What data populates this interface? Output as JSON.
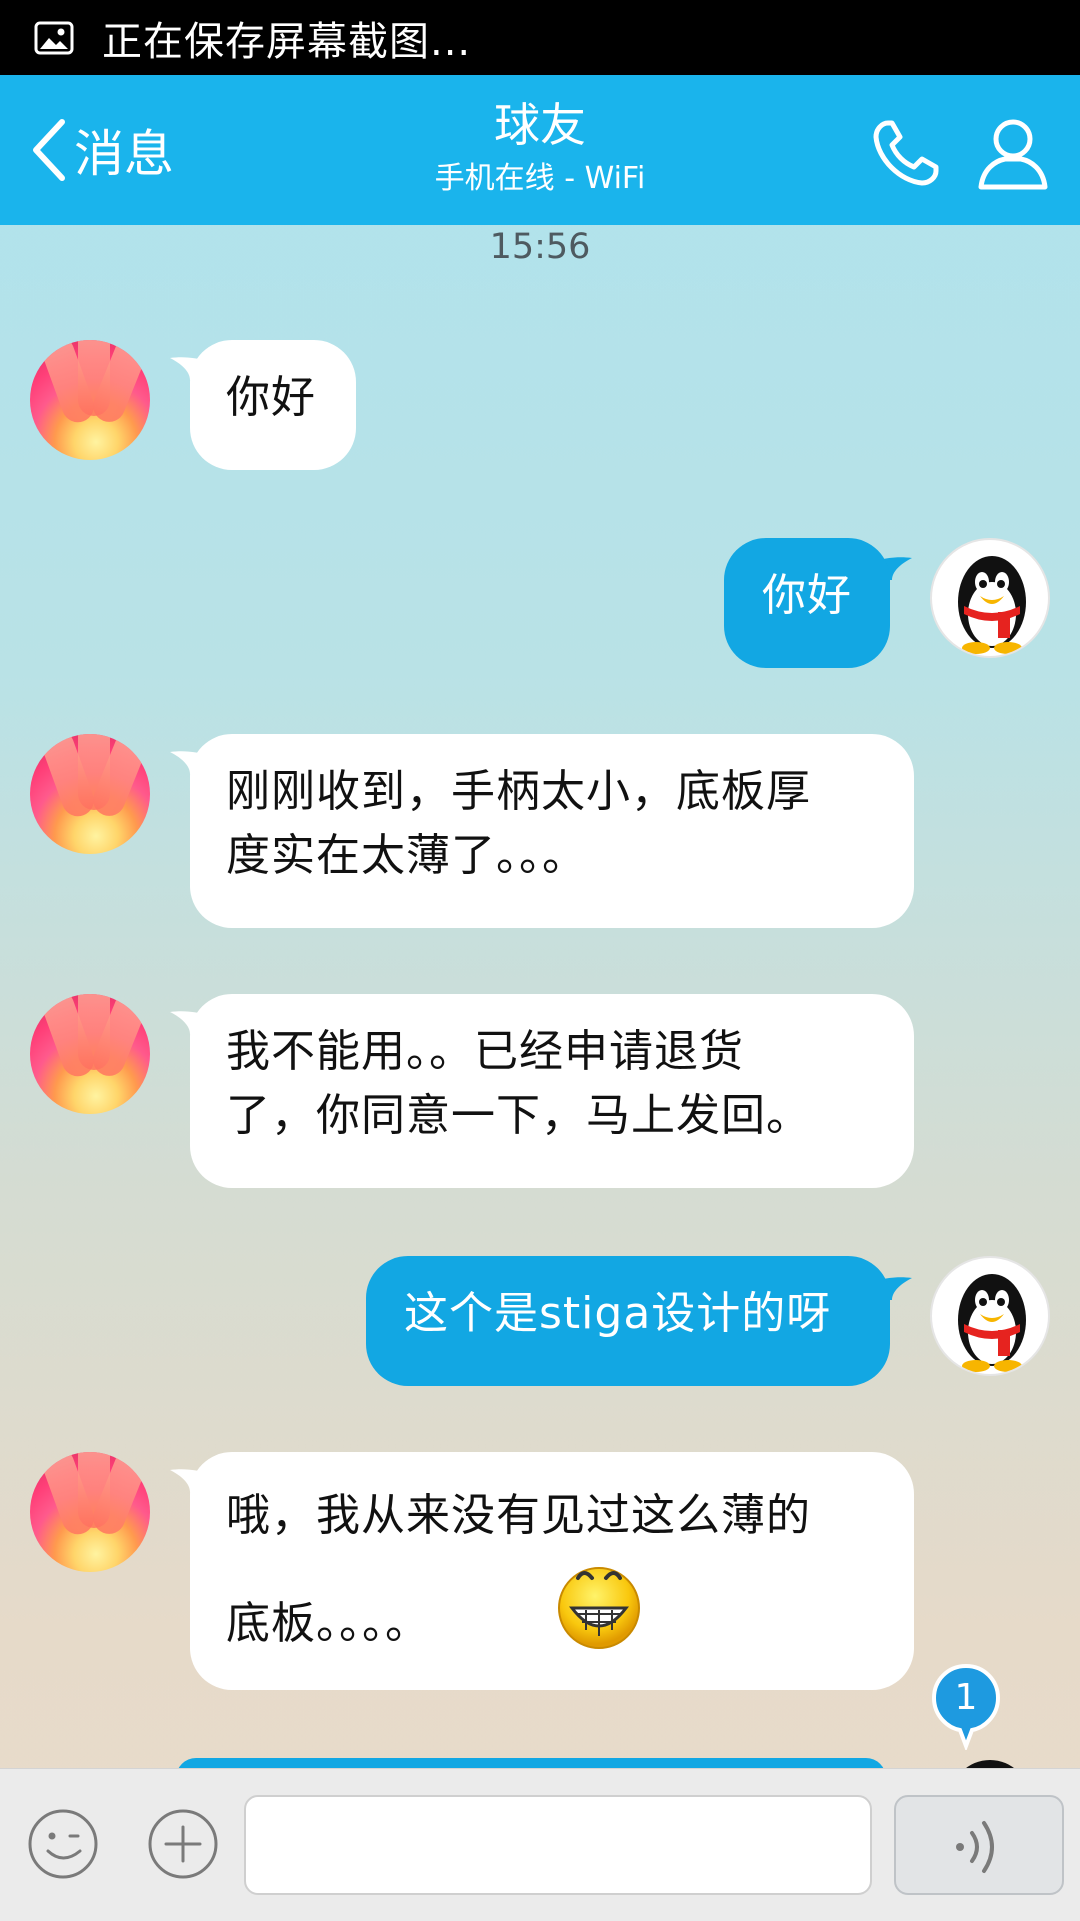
{
  "status_bar": {
    "notification": "正在保存屏幕截图..."
  },
  "header": {
    "back_label": "消息",
    "title": "球友",
    "subtitle": "手机在线 - WiFi"
  },
  "conversation": {
    "timestamp": "15:56",
    "messages": [
      {
        "side": "incoming",
        "text": "你好"
      },
      {
        "side": "outgoing",
        "text": "你好"
      },
      {
        "side": "incoming",
        "line1": "刚刚收到，手柄太小，底板厚",
        "line2": "度实在太薄了。。。"
      },
      {
        "side": "incoming",
        "line1": "我不能用。。已经申请退货",
        "line2": "了，你同意一下，马上发回。"
      },
      {
        "side": "outgoing",
        "text": "这个是stiga设计的呀"
      },
      {
        "side": "incoming",
        "line1": "哦，我从来没有见过这么薄的",
        "line2": "底板。。。。",
        "emoji": "grin-emoji"
      }
    ],
    "unread_count": "1"
  },
  "input_bar": {
    "message_value": "",
    "icons": [
      "emoji-icon",
      "plus-icon",
      "voice-icon"
    ]
  },
  "colors": {
    "title_bar": "#1ab4ec",
    "outgoing_bubble": "#12a7e3",
    "incoming_bubble": "#ffffff"
  }
}
